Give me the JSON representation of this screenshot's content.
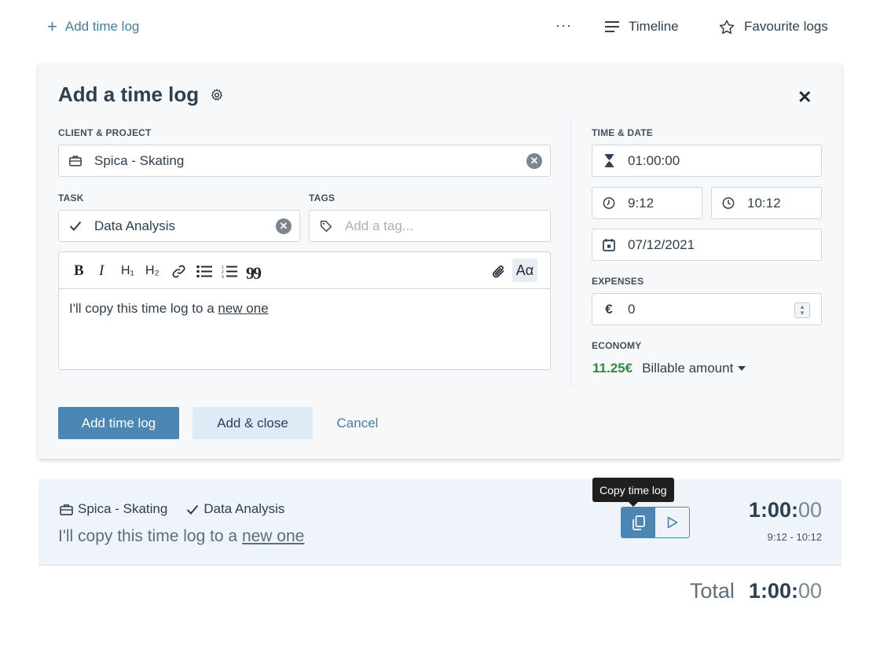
{
  "topbar": {
    "add_label": "Add time log",
    "more_label": "···",
    "timeline_label": "Timeline",
    "favourites_label": "Favourite logs"
  },
  "form": {
    "title": "Add a time log",
    "client_project": {
      "label": "CLIENT & PROJECT",
      "value": "Spica - Skating"
    },
    "task": {
      "label": "TASK",
      "value": "Data Analysis"
    },
    "tags": {
      "label": "TAGS",
      "placeholder": "Add a tag..."
    },
    "editor": {
      "toolbar": {
        "bold": "B",
        "italic": "I",
        "h1": "H₁",
        "h2": "H₂",
        "text_style": "Aα"
      },
      "text_prefix": "I'll copy this time log to a ",
      "text_link": "new one"
    },
    "time_date": {
      "label": "TIME & DATE",
      "duration": "01:00:00",
      "start": "9:12",
      "end": "10:12",
      "date": "07/12/2021"
    },
    "expenses": {
      "label": "EXPENSES",
      "currency": "€",
      "value": "0"
    },
    "economy": {
      "label": "ECONOMY",
      "amount": "11.25€",
      "type": "Billable amount"
    },
    "buttons": {
      "add": "Add time log",
      "add_close": "Add & close",
      "cancel": "Cancel"
    }
  },
  "entry": {
    "project": "Spica - Skating",
    "task": "Data Analysis",
    "description_prefix": "I'll copy this time log to a ",
    "description_link": "new one",
    "tooltip": "Copy time log",
    "duration_main": "1:00:",
    "duration_sec": "00",
    "range": "9:12 - 10:12"
  },
  "total": {
    "label": "Total",
    "main": "1:00:",
    "sec": "00"
  },
  "colors": {
    "accent": "#4c86b5",
    "link": "#3f7fb0",
    "economy": "#2f8a3b",
    "card_bg": "#f6f8fa",
    "entry_bg": "#eef4f9"
  }
}
